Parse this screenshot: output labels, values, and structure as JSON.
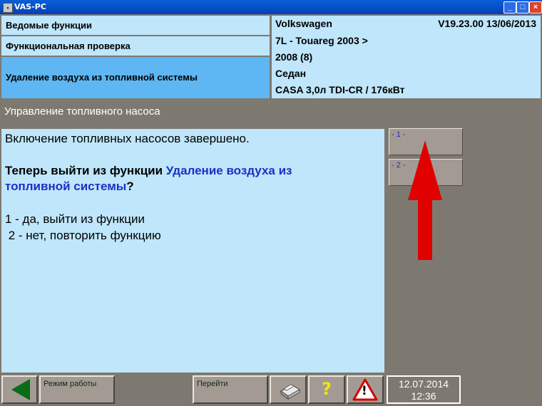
{
  "window": {
    "title": "VAS-PC",
    "minimize": "_",
    "maximize": "□",
    "close": "×"
  },
  "nav": {
    "items": [
      {
        "label": "Ведомые функции"
      },
      {
        "label": "Функциональная проверка"
      },
      {
        "label": "Удаление воздуха из топливной системы"
      }
    ]
  },
  "vehicle": {
    "make": "Volkswagen",
    "version": "V19.23.00 13/06/2013",
    "model": "7L - Touareg 2003 >",
    "year": "2008 (8)",
    "body": "Седан",
    "engine": "CASA 3,0л TDI-CR / 176кВт"
  },
  "section_title": "Управление топливного насоса",
  "content": {
    "status": "Включение топливных насосов завершено.",
    "question_prefix": "Теперь выйти из функции ",
    "question_link_1": "Удаление воздуха из",
    "question_link_2": "топливной системы",
    "question_suffix": "?",
    "option_1": "1 - да, выйти из функции",
    "option_2": " 2 - нет, повторить функцию"
  },
  "side_buttons": [
    {
      "label": "- 1 -"
    },
    {
      "label": "- 2 -"
    }
  ],
  "footer": {
    "mode_label": "Режим работы",
    "goto_label": "Перейти",
    "help_glyph": "?",
    "warning_glyph": "!",
    "date": "12.07.2014",
    "time": "12:36"
  },
  "colors": {
    "panel_light": "#bfe6fa",
    "nav_active": "#5eb6f2",
    "chrome": "#7e7970",
    "link_blue": "#1a2fc8",
    "annotation_arrow": "#e00000",
    "back_green": "#0a6b18"
  }
}
